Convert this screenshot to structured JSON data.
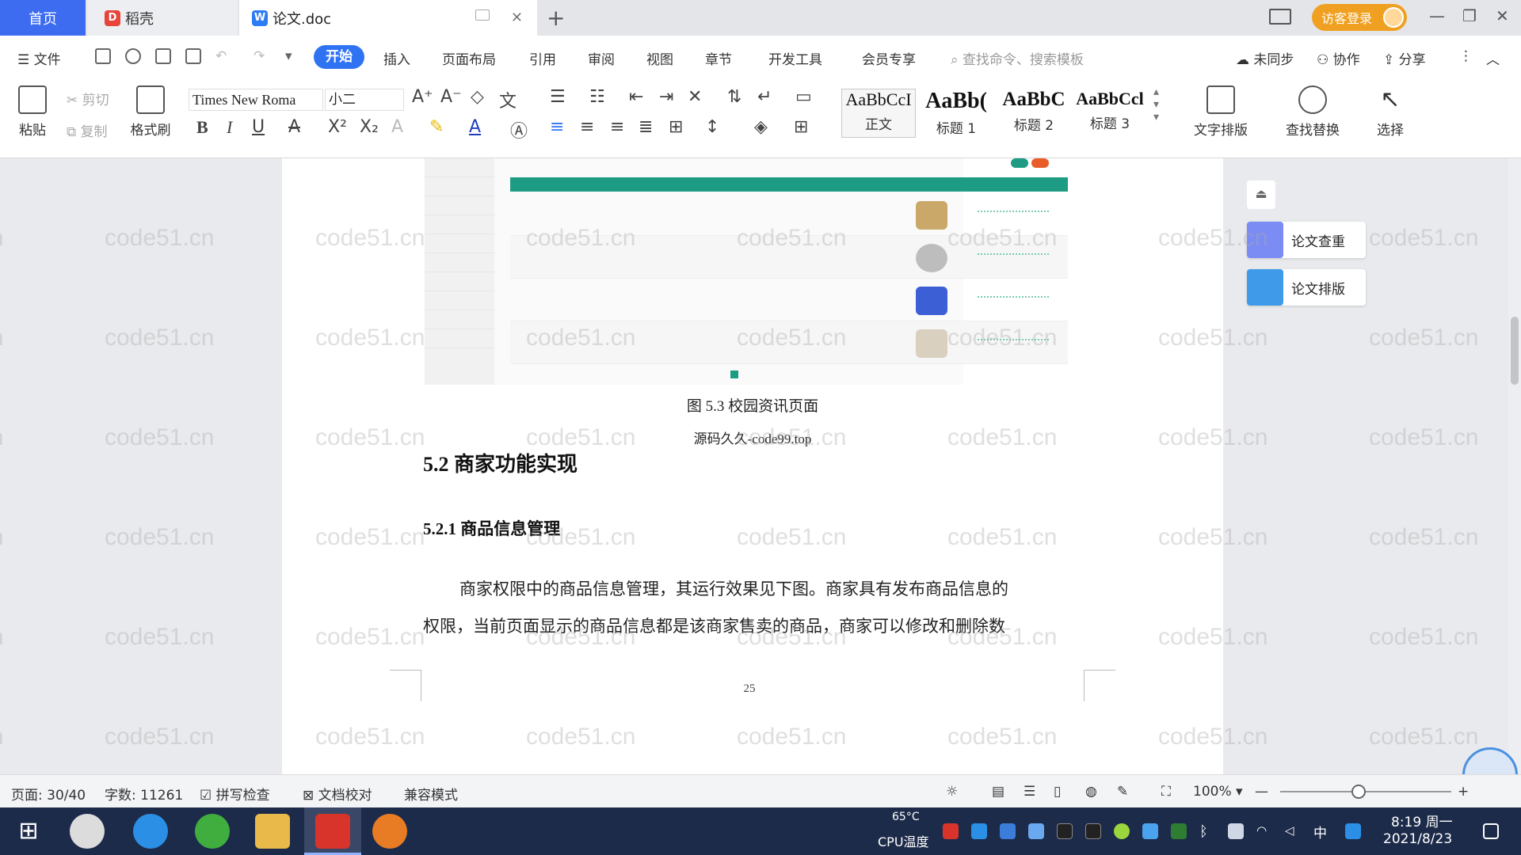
{
  "tabs": {
    "home": "首页",
    "daoke": "稻壳",
    "doc": "论文.doc",
    "daoke_icon": "daoke-logo-icon",
    "doc_icon": "wps-writer-icon"
  },
  "titlebar": {
    "visitor_login": "访客登录"
  },
  "menu": {
    "file": "文件",
    "items": [
      "开始",
      "插入",
      "页面布局",
      "引用",
      "审阅",
      "视图",
      "章节",
      "开发工具",
      "会员专享"
    ],
    "search_placeholder": "查找命令、搜索模板",
    "sync": "未同步",
    "collab": "协作",
    "share": "分享"
  },
  "ribbon": {
    "paste": "粘贴",
    "cut": "剪切",
    "copy": "复制",
    "format_painter": "格式刷",
    "font_name": "Times New Roma",
    "font_size": "小二",
    "styles": [
      {
        "sample": "AaBbCcI",
        "name": "正文"
      },
      {
        "sample": "AaBb(",
        "name": "标题 1"
      },
      {
        "sample": "AaBbC",
        "name": "标题 2"
      },
      {
        "sample": "AaBbCcl",
        "name": "标题 3"
      }
    ],
    "text_layout": "文字排版",
    "find_replace": "查找替换",
    "select": "选择"
  },
  "document": {
    "figure_caption": "图 5.3  校园资讯页面",
    "source_note": "源码久久-code99.top",
    "heading2": "5.2  商家功能实现",
    "heading3": "5.2.1  商品信息管理",
    "para_line1": "商家权限中的商品信息管理，其运行效果见下图。商家具有发布商品信息的",
    "para_line2": "权限，当前页面显示的商品信息都是该商家售卖的商品，商家可以修改和删除数",
    "page_number": "25",
    "watermark": "code51.cn"
  },
  "side_panel": {
    "check": "论文查重",
    "format": "论文排版"
  },
  "statusbar": {
    "page": "页面: 30/40",
    "words": "字数: 11261",
    "spell": "拼写检查",
    "proof": "文档校对",
    "compat": "兼容模式",
    "zoom": "100%",
    "zoom_level_percent": 100
  },
  "taskbar": {
    "cpu_temp": "65°C",
    "cpu_label": "CPU温度",
    "ime": "中",
    "time": "8:19 周一",
    "date": "2021/8/23"
  }
}
